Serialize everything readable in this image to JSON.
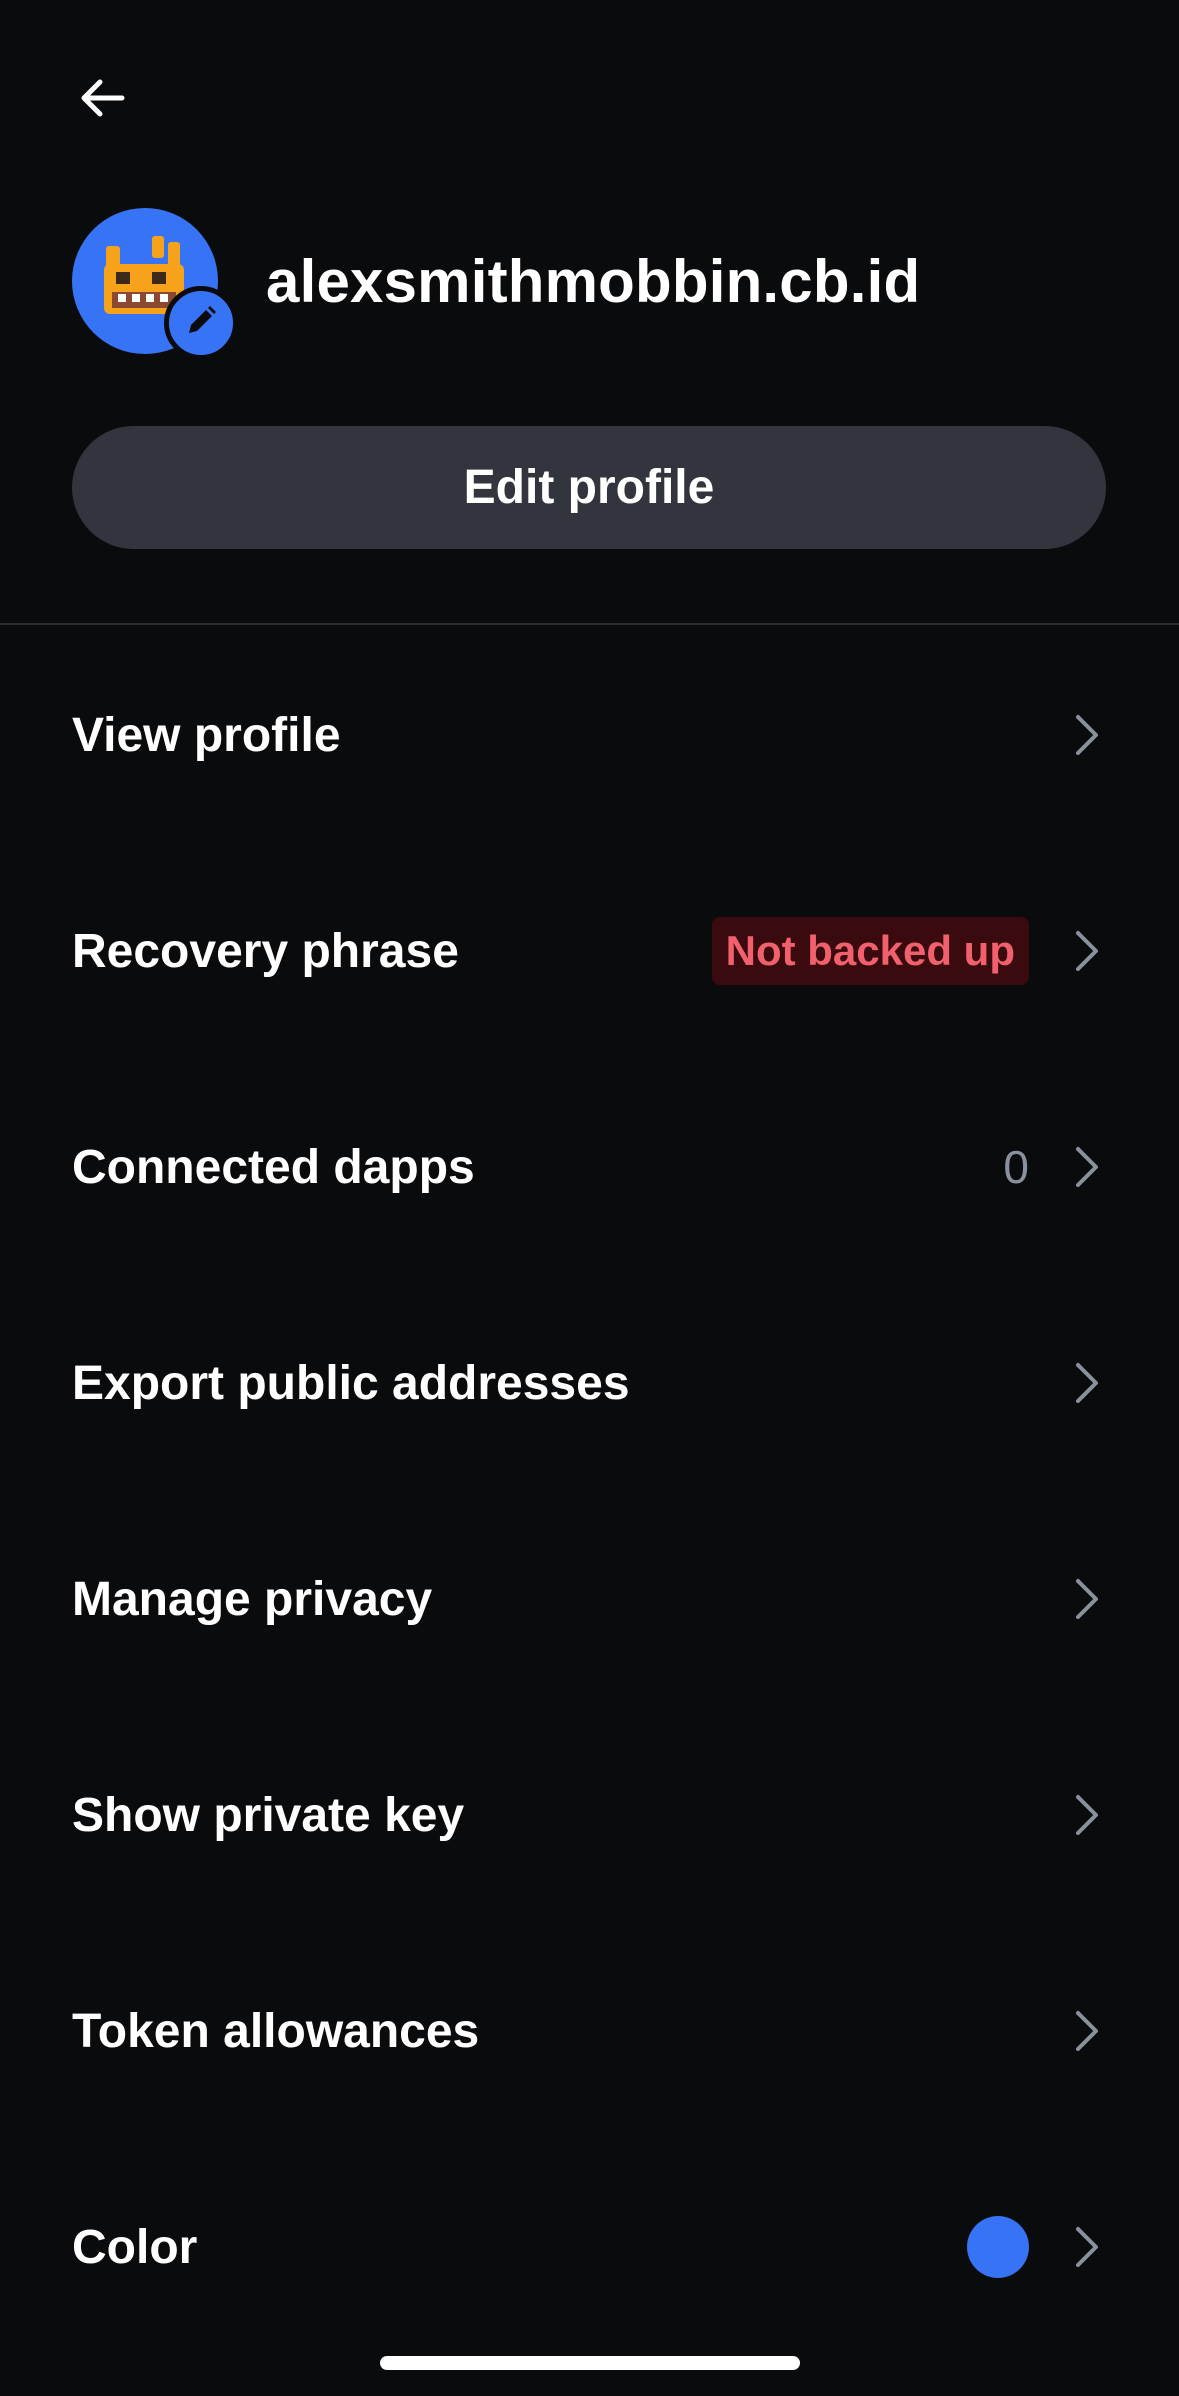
{
  "header": {
    "back_icon": "arrow-left-icon",
    "avatar_icon": "robot-avatar-icon",
    "avatar_edit_icon": "pencil-icon",
    "username": "alexsmithmobbin.cb.id"
  },
  "edit_profile_label": "Edit profile",
  "menu": {
    "items": [
      {
        "label": "View profile"
      },
      {
        "label": "Recovery phrase",
        "badge": "Not backed up"
      },
      {
        "label": "Connected dapps",
        "count": "0"
      },
      {
        "label": "Export public addresses"
      },
      {
        "label": "Manage privacy"
      },
      {
        "label": "Show private key"
      },
      {
        "label": "Token allowances"
      },
      {
        "label": "Color",
        "color": "#3773f5"
      }
    ]
  },
  "colors": {
    "background": "#0a0b0d",
    "accent": "#3773f5",
    "button_bg": "#32353d",
    "badge_bg": "#3b0a0e",
    "badge_text": "#f0616d",
    "muted": "#8a919e"
  }
}
